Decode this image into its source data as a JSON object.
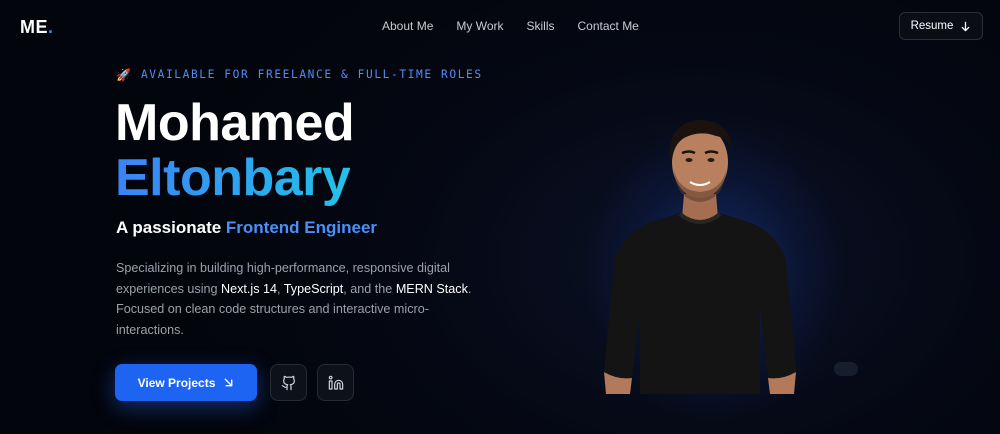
{
  "nav": {
    "logo_text": "ME",
    "logo_dot": ".",
    "links": [
      {
        "label": "About Me"
      },
      {
        "label": "My Work"
      },
      {
        "label": "Skills"
      },
      {
        "label": "Contact Me"
      }
    ],
    "resume_label": "Resume"
  },
  "hero": {
    "tagline": "AVAILABLE FOR FREELANCE & FULL-TIME ROLES",
    "first_name": "Mohamed",
    "last_name": "Eltonbary",
    "subtitle_prefix": "A passionate ",
    "subtitle_highlight": "Frontend Engineer",
    "desc_1": "Specializing in building high-performance, responsive digital experiences using ",
    "tech_1": "Next.js 14",
    "desc_2": ", ",
    "tech_2": "TypeScript",
    "desc_3": ", and the ",
    "tech_3": "MERN Stack",
    "desc_4": ". Focused on clean code structures and interactive micro-interactions.",
    "cta_label": "View Projects"
  },
  "icons": {
    "rocket": "rocket-icon",
    "resume": "arrow-down-icon",
    "cta": "arrow-down-right-icon",
    "github": "github-icon",
    "linkedin": "linkedin-icon"
  },
  "colors": {
    "accent": "#1d64f2",
    "highlight": "#4c8ff6",
    "gradient_start": "#3b82f6",
    "gradient_end": "#22c3e8",
    "background": "#03050c"
  }
}
